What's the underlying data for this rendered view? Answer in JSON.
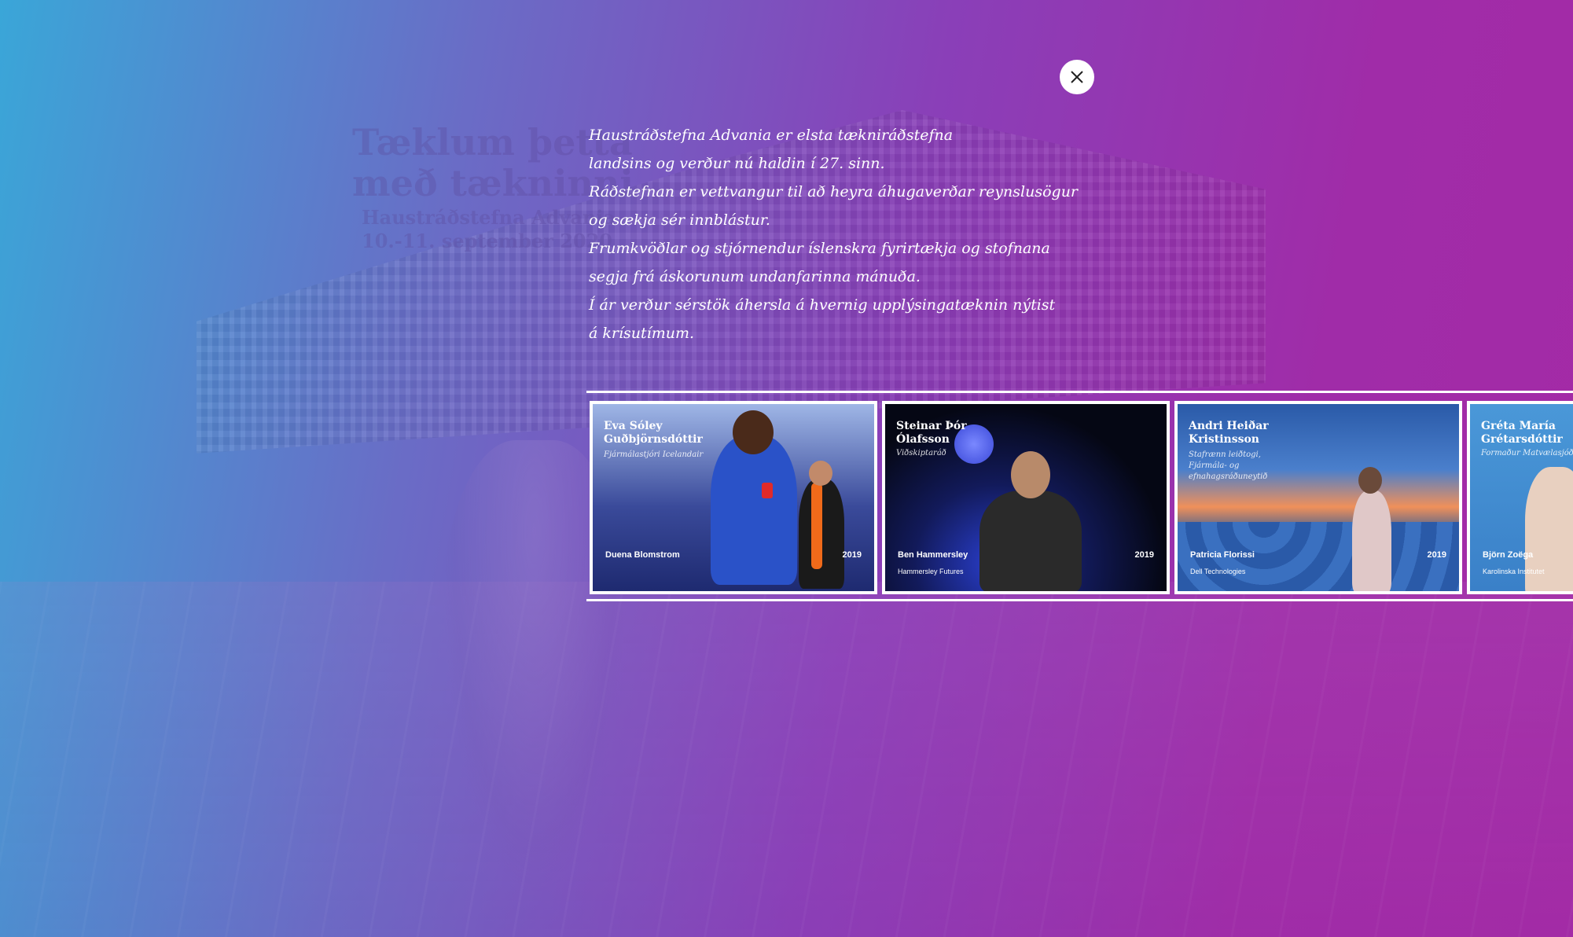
{
  "background": {
    "headline": "Tæklum þetta\nmeð tækninni",
    "subline": "Haustráðstefna Advania\n10.-11. september 2020"
  },
  "close_button": {
    "icon": "close-icon"
  },
  "description": {
    "lines": [
      "Haustráðstefna Advania er elsta tækniráðstefna",
      "landsins og verður nú haldin í 27. sinn.",
      "Ráðstefnan er vettvangur til að heyra áhugaverðar reynslusögur",
      "og sækja sér innblástur.",
      "Frumkvöðlar og stjórnendur íslenskra fyrirtækja og stofnana",
      "segja frá áskorunum undanfarinna mánuða.",
      "Í ár verður sérstök áhersla á hvernig upplýsingatæknin nýtist",
      "á krísutímum."
    ]
  },
  "cards": [
    {
      "speaker": "Eva Sóley\nGuðbjörnsdóttir",
      "role": "Fjármálastjóri Icelandair",
      "presenter": "Duena Blomstrom",
      "presenter_org": "",
      "year": "2019",
      "bg": "#2a3a8a",
      "accent": "#6b9be0"
    },
    {
      "speaker": "Steinar Þór\nÓlafsson",
      "role": "Viðskiptaráð",
      "presenter": "Ben Hammersley",
      "presenter_org": "Hammersley Futures",
      "year": "2019",
      "bg": "#0a0d2a",
      "accent": "#2a3fcf"
    },
    {
      "speaker": "Andri Heiðar\nKristinsson",
      "role": "Stafrænn leiðtogi,\nFjármála- og\nefnahagsráðuneytið",
      "presenter": "Patricia Florissi",
      "presenter_org": "Dell Technologies",
      "year": "2019",
      "bg": "#2d6fb8",
      "accent": "#f0a050"
    },
    {
      "speaker": "Gréta María\nGrétarsdóttir",
      "role": "Formaður Matvælasjóðs",
      "presenter": "Björn Zoëga",
      "presenter_org": "Karolinska Institutet",
      "year": "",
      "bg": "#3a88cc",
      "accent": "#d8b89a"
    }
  ]
}
